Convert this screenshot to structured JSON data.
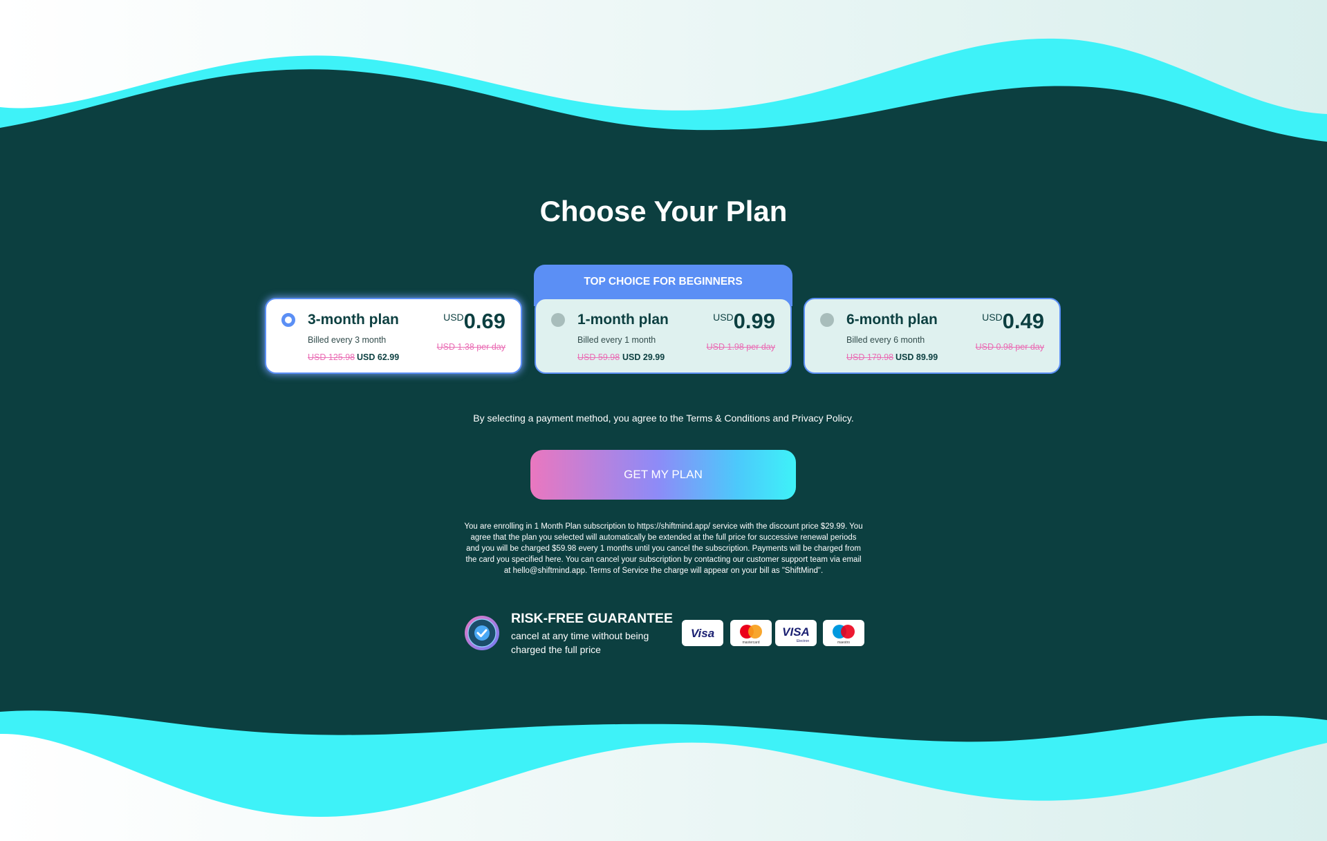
{
  "title": "Choose Your Plan",
  "badge": "TOP CHOICE FOR BEGINNERS",
  "plans": [
    {
      "name": "3-month plan",
      "billed": "Billed every 3 month",
      "old_total": "USD 125.98",
      "new_total": "USD 62.99",
      "currency": "USD",
      "price": "0.69",
      "per_day": "USD 1.38 per day",
      "selected": true
    },
    {
      "name": "1-month plan",
      "billed": "Billed every 1 month",
      "old_total": "USD 59.98",
      "new_total": "USD 29.99",
      "currency": "USD",
      "price": "0.99",
      "per_day": "USD 1.98 per day",
      "selected": false
    },
    {
      "name": "6-month plan",
      "billed": "Billed every 6 month",
      "old_total": "USD 179.98",
      "new_total": "USD 89.99",
      "currency": "USD",
      "price": "0.49",
      "per_day": "USD 0.98 per day",
      "selected": false
    }
  ],
  "terms_text": "By selecting a payment method, you agree to the Terms & Conditions and Privacy Policy.",
  "cta_label": "GET MY PLAN",
  "disclaimer": "You are enrolling in 1 Month Plan subscription to https://shiftmind.app/ service with the discount price $29.99. You agree that the plan you selected will automatically be extended at the full price for successive renewal periods and you will be charged $59.98 every 1 months until you cancel the subscription. Payments will be charged from the card you specified here. You can cancel your subscription by contacting our customer support team via email at hello@shiftmind.app. Terms of Service the charge will appear on your bill as \"ShiftMind\".",
  "guarantee": {
    "title": "RISK-FREE GUARANTEE",
    "text": "cancel at any time without being charged the full price",
    "seal_icon": "money-back-guarantee-seal-icon"
  },
  "payment_methods": [
    {
      "name": "Visa",
      "icon": "visa-icon"
    },
    {
      "name": "Mastercard",
      "icon": "mastercard-icon",
      "sub_label": "mastercard"
    },
    {
      "name": "Visa Electron",
      "icon": "visa-electron-icon",
      "sub_label": "Electron"
    },
    {
      "name": "Maestro",
      "icon": "maestro-icon",
      "sub_label": "maestro"
    }
  ],
  "colors": {
    "background": "#0c3f40",
    "wave_cyan": "#3ef2f8",
    "accent_blue": "#5b8ff5",
    "strike_pink": "#ea6cb4",
    "card_bg": "#dff1ef"
  }
}
